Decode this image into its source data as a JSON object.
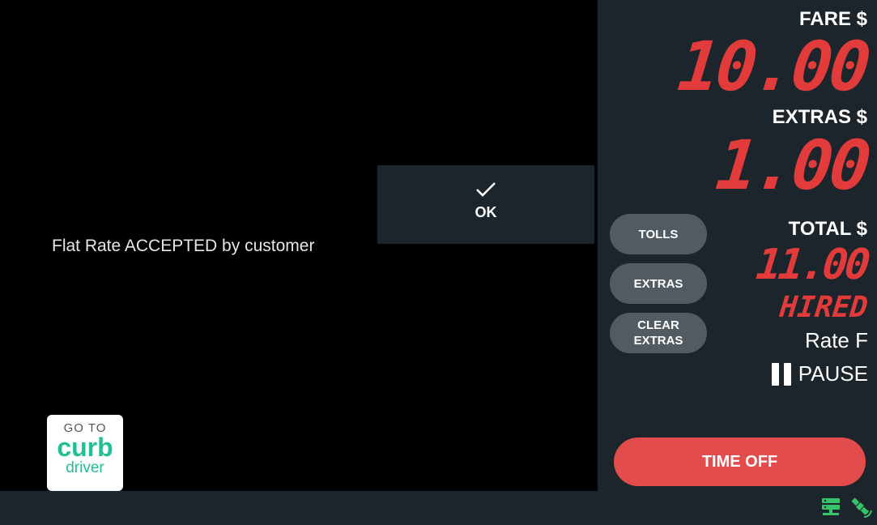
{
  "left": {
    "message": "Flat Rate ACCEPTED by customer",
    "dialog": {
      "ok_label": "OK",
      "icon": "check-icon"
    },
    "curb_badge": {
      "goto": "GO TO",
      "brand": "curb",
      "sub": "driver"
    }
  },
  "meter": {
    "fare_label": "FARE $",
    "fare_value": "10.00",
    "extras_label": "EXTRAS $",
    "extras_value": "1.00",
    "total_label": "TOTAL $",
    "total_value": "11.00",
    "status": "HIRED",
    "rate": "Rate F",
    "pause_label": "PAUSE",
    "buttons": {
      "tolls": "TOLLS",
      "extras": "EXTRAS",
      "clear_extras_1": "CLEAR",
      "clear_extras_2": "EXTRAS"
    },
    "time_off": "TIME OFF"
  },
  "status_icons": [
    "server-icon",
    "satellite-icon"
  ],
  "colors": {
    "accent_red": "#e23b3b",
    "panel": "#1c252b",
    "button_gray": "#535b62",
    "time_off": "#e34c4c",
    "icon_green": "#36c46b"
  }
}
